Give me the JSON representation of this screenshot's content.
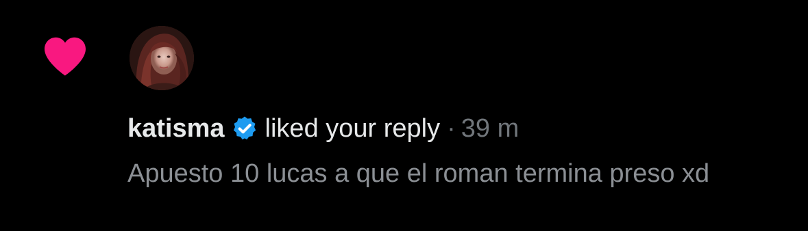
{
  "notification": {
    "type_icon": "heart-icon",
    "type_icon_color": "#f91880",
    "avatar_icon": "user-avatar",
    "username": "katisma",
    "verified_icon": "verified-badge-icon",
    "verified_color": "#1d9bf0",
    "action_text": "liked your reply",
    "separator": "·",
    "time_ago": "39 m",
    "reply_text": "Apuesto 10 lucas a que el roman termina preso xd"
  }
}
